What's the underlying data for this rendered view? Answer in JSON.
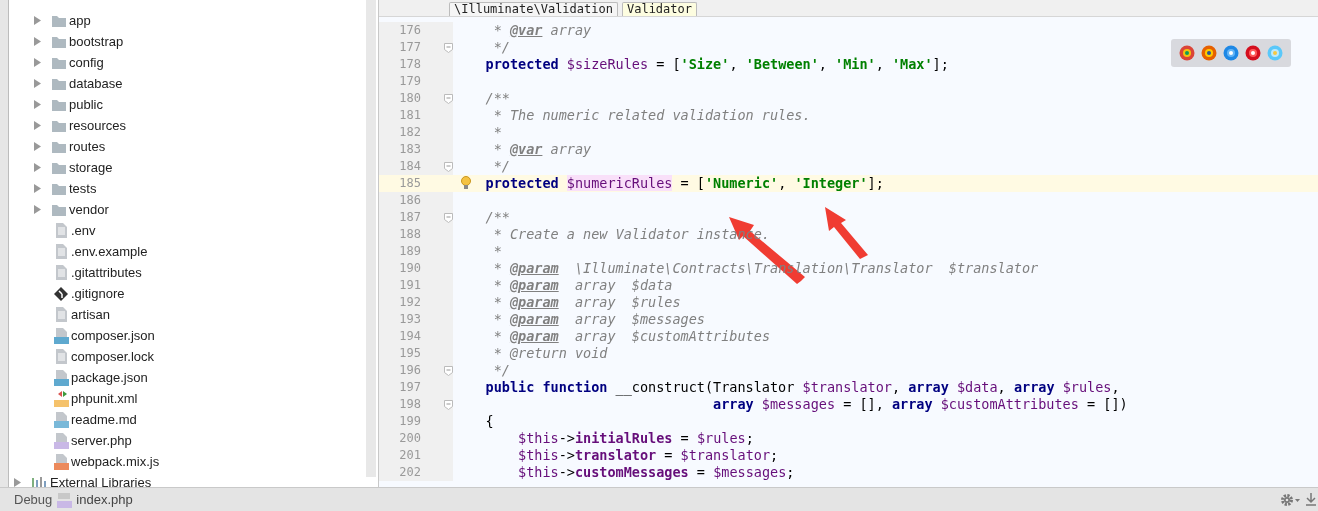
{
  "project_tree": {
    "items": [
      {
        "kind": "folder",
        "label": "app",
        "expanded": false
      },
      {
        "kind": "folder",
        "label": "bootstrap",
        "expanded": false
      },
      {
        "kind": "folder",
        "label": "config",
        "expanded": false
      },
      {
        "kind": "folder",
        "label": "database",
        "expanded": false
      },
      {
        "kind": "folder",
        "label": "public",
        "expanded": false
      },
      {
        "kind": "folder",
        "label": "resources",
        "expanded": false
      },
      {
        "kind": "folder",
        "label": "routes",
        "expanded": false
      },
      {
        "kind": "folder",
        "label": "storage",
        "expanded": false
      },
      {
        "kind": "folder",
        "label": "tests",
        "expanded": false
      },
      {
        "kind": "folder",
        "label": "vendor",
        "expanded": false
      },
      {
        "kind": "text",
        "label": ".env"
      },
      {
        "kind": "text",
        "label": ".env.example"
      },
      {
        "kind": "text",
        "label": ".gitattributes"
      },
      {
        "kind": "git",
        "label": ".gitignore"
      },
      {
        "kind": "text",
        "label": "artisan"
      },
      {
        "kind": "json",
        "label": "composer.json"
      },
      {
        "kind": "text",
        "label": "composer.lock"
      },
      {
        "kind": "json",
        "label": "package.json"
      },
      {
        "kind": "xml",
        "label": "phpunit.xml"
      },
      {
        "kind": "md",
        "label": "readme.md"
      },
      {
        "kind": "php",
        "label": "server.php"
      },
      {
        "kind": "js",
        "label": "webpack.mix.js"
      },
      {
        "kind": "libraries",
        "label": "External Libraries",
        "expanded": false
      }
    ]
  },
  "breadcrumbs": [
    {
      "label": "\\Illuminate\\Validation",
      "selected": false
    },
    {
      "label": "Validator",
      "selected": true
    }
  ],
  "editor": {
    "lines": [
      {
        "number": "176",
        "fold": false,
        "current": false,
        "tokens": [
          {
            "kind": "comment",
            "text": "     * "
          },
          {
            "kind": "tag",
            "text": "@var"
          },
          {
            "kind": "comment",
            "text": " array"
          }
        ]
      },
      {
        "number": "177",
        "fold": true,
        "current": false,
        "tokens": [
          {
            "kind": "comment",
            "text": "     */"
          }
        ]
      },
      {
        "number": "178",
        "fold": false,
        "current": false,
        "tokens": [
          {
            "kind": "keyword",
            "text": "    protected"
          },
          {
            "kind": "variable",
            "text": " $sizeRules"
          },
          {
            "kind": "plain",
            "text": " = ["
          },
          {
            "kind": "string",
            "text": "'Size'"
          },
          {
            "kind": "plain",
            "text": ", "
          },
          {
            "kind": "string",
            "text": "'Between'"
          },
          {
            "kind": "plain",
            "text": ", "
          },
          {
            "kind": "string",
            "text": "'Min'"
          },
          {
            "kind": "plain",
            "text": ", "
          },
          {
            "kind": "string",
            "text": "'Max'"
          },
          {
            "kind": "plain",
            "text": "];"
          }
        ]
      },
      {
        "number": "179",
        "fold": false,
        "current": false
      },
      {
        "number": "180",
        "fold": true,
        "current": false,
        "tokens": [
          {
            "kind": "comment",
            "text": "    /**"
          }
        ]
      },
      {
        "number": "181",
        "fold": false,
        "current": false,
        "tokens": [
          {
            "kind": "comment",
            "text": "     * The numeric related validation rules."
          }
        ]
      },
      {
        "number": "182",
        "fold": false,
        "current": false,
        "tokens": [
          {
            "kind": "comment",
            "text": "     *"
          }
        ]
      },
      {
        "number": "183",
        "fold": false,
        "current": false,
        "tokens": [
          {
            "kind": "comment",
            "text": "     * "
          },
          {
            "kind": "tag",
            "text": "@var"
          },
          {
            "kind": "comment",
            "text": " array"
          }
        ]
      },
      {
        "number": "184",
        "fold": true,
        "current": false,
        "tokens": [
          {
            "kind": "comment",
            "text": "     */"
          }
        ]
      },
      {
        "number": "185",
        "fold": false,
        "current": true,
        "tokens": [
          {
            "kind": "keyword",
            "text": "    protected "
          },
          {
            "kind": "highlighted",
            "text": "$numericRules"
          },
          {
            "kind": "plain",
            "text": " = ["
          },
          {
            "kind": "string",
            "text": "'Numeric'"
          },
          {
            "kind": "plain",
            "text": ", "
          },
          {
            "kind": "string",
            "text": "'Integer'"
          },
          {
            "kind": "plain",
            "text": "];"
          }
        ]
      },
      {
        "number": "186",
        "fold": false,
        "current": false
      },
      {
        "number": "187",
        "fold": true,
        "current": false,
        "tokens": [
          {
            "kind": "comment",
            "text": "    /**"
          }
        ]
      },
      {
        "number": "188",
        "fold": false,
        "current": false,
        "tokens": [
          {
            "kind": "comment",
            "text": "     * Create a new Validator instance."
          }
        ]
      },
      {
        "number": "189",
        "fold": false,
        "current": false,
        "tokens": [
          {
            "kind": "comment",
            "text": "     *"
          }
        ]
      },
      {
        "number": "190",
        "fold": false,
        "current": false,
        "tokens": [
          {
            "kind": "comment",
            "text": "     * "
          },
          {
            "kind": "tag",
            "text": "@param"
          },
          {
            "kind": "comment",
            "text": "  \\Illuminate\\Contracts\\Translation\\Translator  $translator"
          }
        ]
      },
      {
        "number": "191",
        "fold": false,
        "current": false,
        "tokens": [
          {
            "kind": "comment",
            "text": "     * "
          },
          {
            "kind": "tag",
            "text": "@param"
          },
          {
            "kind": "comment",
            "text": "  array  $data"
          }
        ]
      },
      {
        "number": "192",
        "fold": false,
        "current": false,
        "tokens": [
          {
            "kind": "comment",
            "text": "     * "
          },
          {
            "kind": "tag",
            "text": "@param"
          },
          {
            "kind": "comment",
            "text": "  array  $rules"
          }
        ]
      },
      {
        "number": "193",
        "fold": false,
        "current": false,
        "tokens": [
          {
            "kind": "comment",
            "text": "     * "
          },
          {
            "kind": "tag",
            "text": "@param"
          },
          {
            "kind": "comment",
            "text": "  array  $messages"
          }
        ]
      },
      {
        "number": "194",
        "fold": false,
        "current": false,
        "tokens": [
          {
            "kind": "comment",
            "text": "     * "
          },
          {
            "kind": "tag",
            "text": "@param"
          },
          {
            "kind": "comment",
            "text": "  array  $customAttributes"
          }
        ]
      },
      {
        "number": "195",
        "fold": false,
        "current": false,
        "tokens": [
          {
            "kind": "comment",
            "text": "     * @return void"
          }
        ]
      },
      {
        "number": "196",
        "fold": true,
        "current": false,
        "tokens": [
          {
            "kind": "comment",
            "text": "     */"
          }
        ]
      },
      {
        "number": "197",
        "fold": false,
        "current": false,
        "tokens": [
          {
            "kind": "keyword",
            "text": "    public function"
          },
          {
            "kind": "plain",
            "text": " __construct(Translator "
          },
          {
            "kind": "variable",
            "text": "$translator"
          },
          {
            "kind": "plain",
            "text": ", "
          },
          {
            "kind": "keyword",
            "text": "array"
          },
          {
            "kind": "variable",
            "text": " $data"
          },
          {
            "kind": "plain",
            "text": ", "
          },
          {
            "kind": "keyword",
            "text": "array"
          },
          {
            "kind": "variable",
            "text": " $rules"
          },
          {
            "kind": "plain",
            "text": ","
          }
        ]
      },
      {
        "number": "198",
        "fold": true,
        "current": false,
        "tokens": [
          {
            "kind": "keyword",
            "text": "                                array"
          },
          {
            "kind": "variable",
            "text": " $messages"
          },
          {
            "kind": "plain",
            "text": " = [], "
          },
          {
            "kind": "keyword",
            "text": "array"
          },
          {
            "kind": "variable",
            "text": " $customAttributes"
          },
          {
            "kind": "plain",
            "text": " = [])"
          }
        ]
      },
      {
        "number": "199",
        "fold": false,
        "current": false,
        "tokens": [
          {
            "kind": "plain",
            "text": "    {"
          }
        ]
      },
      {
        "number": "200",
        "fold": false,
        "current": false,
        "tokens": [
          {
            "kind": "variable",
            "text": "        $this"
          },
          {
            "kind": "plain",
            "text": "->"
          },
          {
            "kind": "field",
            "text": "initialRules"
          },
          {
            "kind": "plain",
            "text": " = "
          },
          {
            "kind": "variable",
            "text": "$rules"
          },
          {
            "kind": "plain",
            "text": ";"
          }
        ]
      },
      {
        "number": "201",
        "fold": false,
        "current": false,
        "tokens": [
          {
            "kind": "variable",
            "text": "        $this"
          },
          {
            "kind": "plain",
            "text": "->"
          },
          {
            "kind": "field",
            "text": "translator"
          },
          {
            "kind": "plain",
            "text": " = "
          },
          {
            "kind": "variable",
            "text": "$translator"
          },
          {
            "kind": "plain",
            "text": ";"
          }
        ]
      },
      {
        "number": "202",
        "fold": false,
        "current": false,
        "tokens": [
          {
            "kind": "variable",
            "text": "        $this"
          },
          {
            "kind": "plain",
            "text": "->"
          },
          {
            "kind": "field",
            "text": "customMessages"
          },
          {
            "kind": "plain",
            "text": " = "
          },
          {
            "kind": "variable",
            "text": "$messages"
          },
          {
            "kind": "plain",
            "text": ";"
          }
        ]
      }
    ]
  },
  "status_bar": {
    "label": "Debug",
    "file": "index.php"
  }
}
